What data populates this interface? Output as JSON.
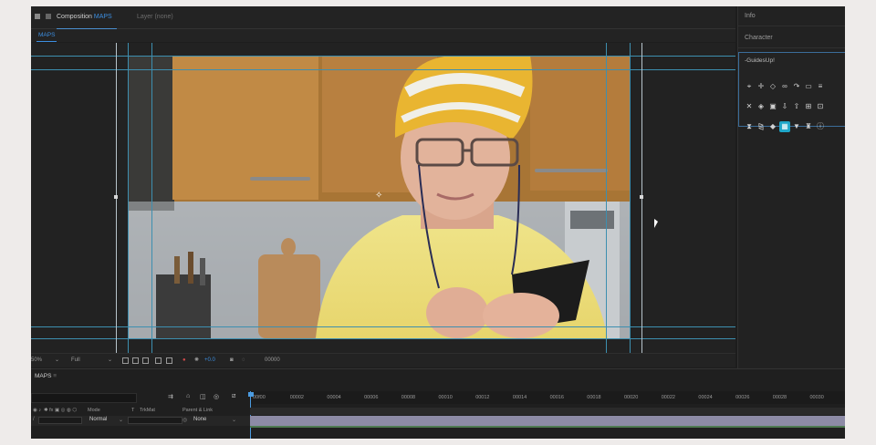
{
  "composition_tab": {
    "prefix": "Composition",
    "name": "MAPS"
  },
  "layer_tab": {
    "prefix": "Layer",
    "value": "(none)"
  },
  "viewer_subtab": "MAPS",
  "viewer_toolbar": {
    "zoom": "50%",
    "resolution": "Full",
    "exposure": "+0.0",
    "timecode": "00000"
  },
  "right_panel": {
    "info": "Info",
    "character": "Character",
    "guides_panel_title": "-GuidesUp!",
    "guide_icons": [
      "center-mark-icon",
      "crosshair-icon",
      "diamond-icon",
      "link-icon",
      "curve-icon",
      "frame-icon",
      "lines-icon",
      "pin-icon",
      "tag-icon",
      "lock-icon",
      "import-icon",
      "export-icon",
      "add-guide-icon",
      "fit-icon",
      "hourglass-icon",
      "mirror-icon",
      "eraser-icon",
      "grid-active-icon",
      "trash-icon",
      "robot-icon",
      "info-icon"
    ]
  },
  "timeline": {
    "tab": "MAPS",
    "ruler": [
      "00f00",
      "00002",
      "00004",
      "00006",
      "00008",
      "00010",
      "00012",
      "00014",
      "00016",
      "00018",
      "00020",
      "00022",
      "00024",
      "00026",
      "00028",
      "00030"
    ],
    "headers": {
      "mode": "Mode",
      "t": "T",
      "trkmat": "TrkMat",
      "parent": "Parent & Link"
    },
    "layer": {
      "mode": "Normal",
      "parent": "None"
    }
  },
  "colors": {
    "accent": "#3c8ee0",
    "guide": "#3d8fb0",
    "layer_bar": "#8d8ba6"
  }
}
